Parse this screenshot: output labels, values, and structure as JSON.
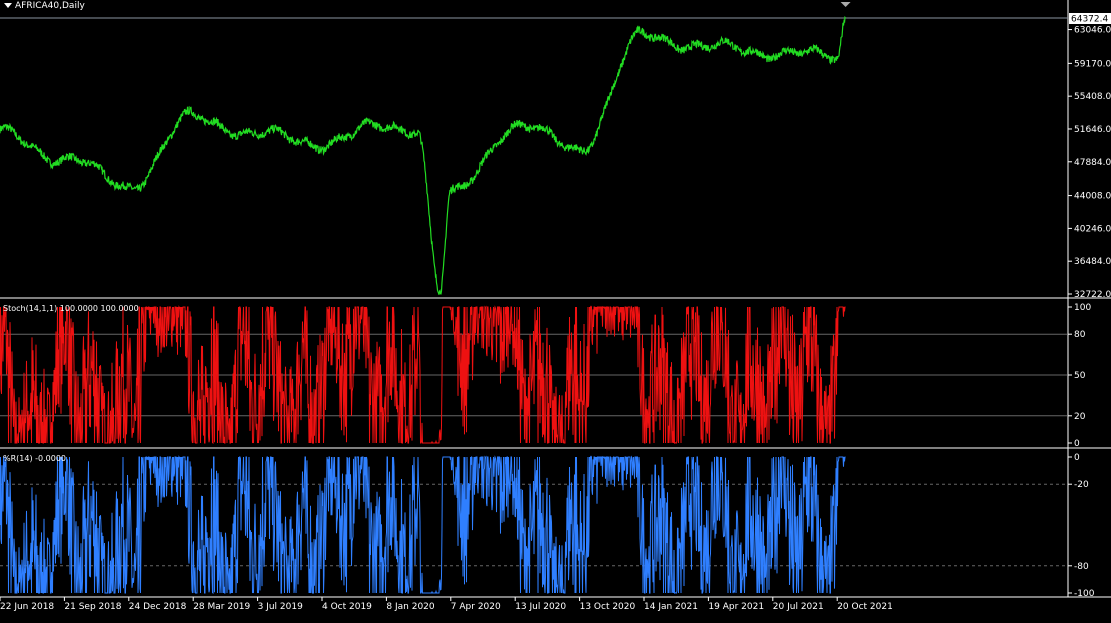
{
  "symbol": "AFRICA40,Daily",
  "colors": {
    "price": "#22dd22",
    "stoch": "#ee1111",
    "wpr": "#2f7fff",
    "grid": "#808080",
    "axis": "#ffffff",
    "background": "#000000"
  },
  "price_panel": {
    "axis_labels": [
      "63046.0",
      "59170.0",
      "55408.0",
      "51646.0",
      "47884.0",
      "44008.0",
      "40246.0",
      "36484.0",
      "32722.0"
    ],
    "last_price": "64372.4"
  },
  "stoch_panel": {
    "title": "Stoch(14,1,1) 100.0000 100.0000",
    "axis_labels": [
      "100",
      "80",
      "50",
      "20",
      "0"
    ]
  },
  "wpr_panel": {
    "title": "%R(14) -0.0000",
    "axis_labels": [
      "0",
      "-20",
      "-80",
      "-100"
    ]
  },
  "x_axis_labels": [
    "22 Jun 2018",
    "21 Sep 2018",
    "24 Dec 2018",
    "28 Mar 2019",
    "3 Jul 2019",
    "4 Oct 2019",
    "8 Jan 2020",
    "7 Apr 2020",
    "13 Jul 2020",
    "13 Oct 2020",
    "14 Jan 2021",
    "19 Apr 2021",
    "20 Jul 2021",
    "20 Oct 2021"
  ],
  "chart_data": [
    {
      "type": "line",
      "series": [
        {
          "x": [
            "22 Jun 2018",
            "21 Sep 2018",
            "24 Dec 2018",
            "28 Mar 2019",
            "3 Jul 2019",
            "4 Oct 2019",
            "8 Jan 2020",
            "7 Apr 2020",
            "13 Jul 2020",
            "13 Oct 2020",
            "14 Jan 2021",
            "19 Apr 2021",
            "20 Jul 2021",
            "20 Oct 2021"
          ],
          "values": [
            51100,
            48300,
            45100,
            53000,
            51000,
            50100,
            52000,
            44000,
            52000,
            49500,
            62400,
            61000,
            60500,
            59800
          ]
        }
      ],
      "extra_points": [
        {
          "date": "20 Feb 2020",
          "value": 51800
        },
        {
          "date": "23 Mar 2020",
          "value": 33000
        },
        {
          "date": "1 Nov 2021",
          "value": 64372.4
        }
      ],
      "ylim": [
        32722,
        64372.4
      ]
    },
    {
      "type": "line",
      "title": "Stoch(14,1,1) 100.0000 100.0000",
      "ylim": [
        0,
        100
      ],
      "levels": [
        80,
        50,
        20
      ],
      "last_value": 100
    },
    {
      "type": "line",
      "title": "%R(14) -0.0000",
      "ylim": [
        -100,
        0
      ],
      "levels": [
        -20,
        -80
      ],
      "last_value": 0
    }
  ]
}
